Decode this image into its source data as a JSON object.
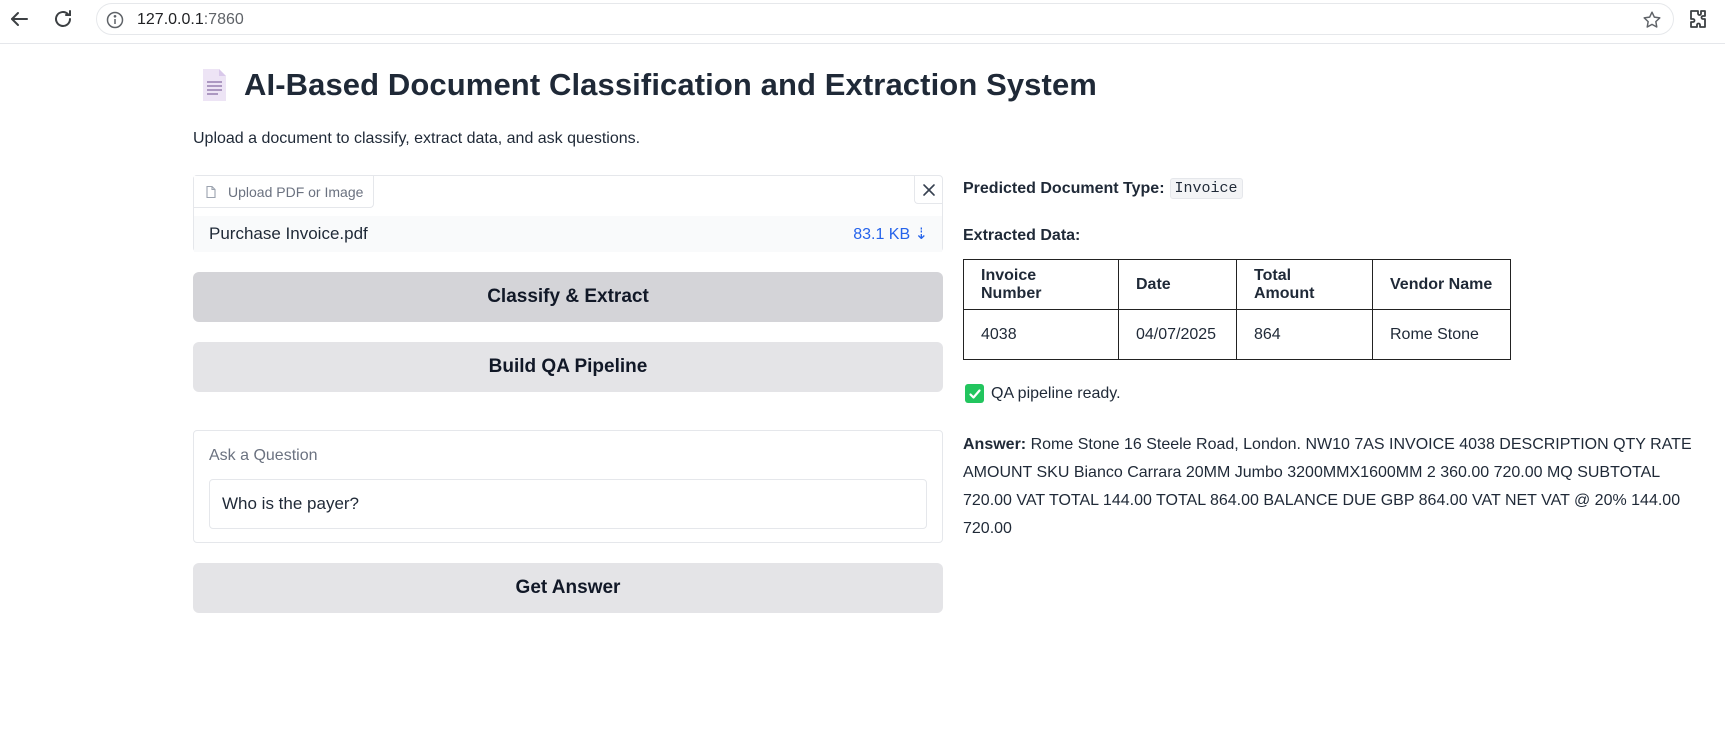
{
  "browser": {
    "url_host": "127.0.0.1",
    "url_port": ":7860"
  },
  "page": {
    "title": "AI-Based Document Classification and Extraction System",
    "subtitle": "Upload a document to classify, extract data, and ask questions."
  },
  "upload": {
    "label": "Upload PDF or Image",
    "file_name": "Purchase Invoice.pdf",
    "file_size": "83.1 KB ⇣"
  },
  "buttons": {
    "classify": "Classify & Extract",
    "build_qa": "Build QA Pipeline",
    "get_answer": "Get Answer"
  },
  "question": {
    "label": "Ask a Question",
    "value": "Who is the payer?"
  },
  "prediction": {
    "label": "Predicted Document Type:",
    "value": "Invoice"
  },
  "extracted": {
    "label": "Extracted Data:",
    "headers": [
      "Invoice Number",
      "Date",
      "Total Amount",
      "Vendor Name"
    ],
    "row": [
      "4038",
      "04/07/2025",
      "864",
      "Rome Stone"
    ]
  },
  "qa_status": "QA pipeline ready.",
  "answer": {
    "label": "Answer:",
    "text": "Rome Stone 16 Steele Road, London. NW10 7AS INVOICE 4038 DESCRIPTION QTY RATE AMOUNT SKU Bianco Carrara 20MM Jumbo 3200MMX1600MM 2 360.00 720.00 MQ SUBTOTAL 720.00 VAT TOTAL 144.00 TOTAL 864.00 BALANCE DUE GBP 864.00 VAT NET VAT @ 20% 144.00 720.00"
  },
  "colors": {
    "primary_button": "#d4d4d8",
    "secondary_button": "#e4e4e7",
    "link_blue": "#2563eb",
    "check_green": "#22c55e"
  },
  "icons": [
    "back-arrow-icon",
    "reload-icon",
    "info-icon",
    "star-icon",
    "extensions-icon",
    "document-icon",
    "file-icon",
    "close-icon",
    "checkmark-icon"
  ]
}
